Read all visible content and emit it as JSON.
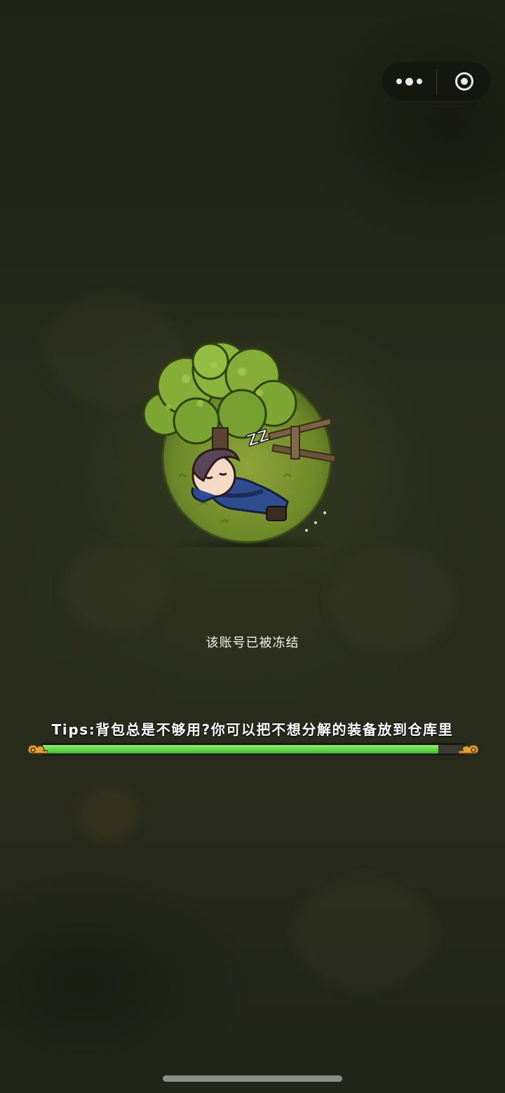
{
  "capsule": {
    "more_icon": "more-dots-icon",
    "close_icon": "target-close-icon"
  },
  "illustration": {
    "zz_text": "ZZ"
  },
  "status": {
    "message": "该账号已被冻结"
  },
  "loading": {
    "tip": "Tips:背包总是不够用?你可以把不想分解的装备放到仓库里",
    "progress": 0.94,
    "fill_color": "#5fd34a"
  }
}
